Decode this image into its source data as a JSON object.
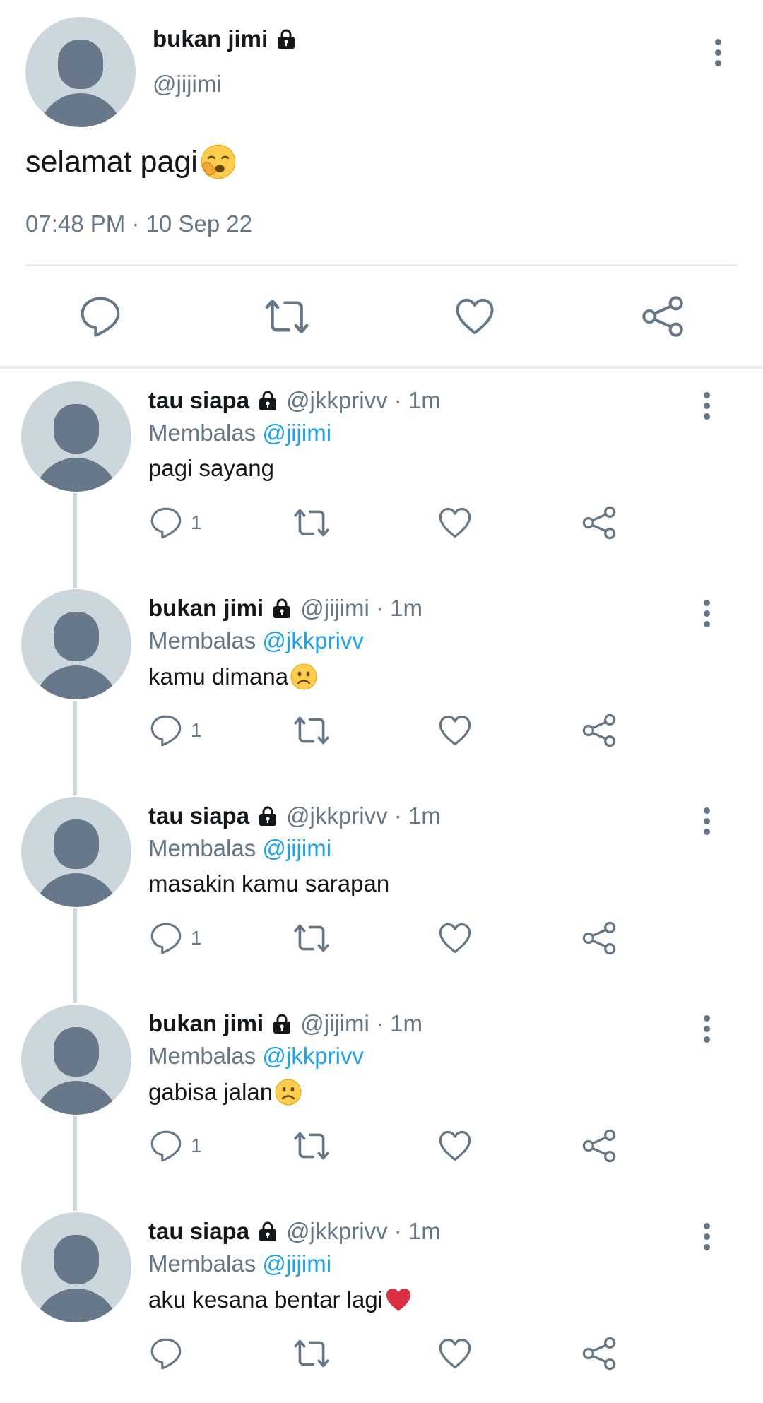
{
  "main_tweet": {
    "name": "bukan jimi",
    "handle": "@jijimi",
    "text": "selamat pagi",
    "text_emoji": "yawning-face-emoji",
    "timestamp": "07:48 PM · 10 Sep 22",
    "actions": [
      "reply-icon",
      "retweet-icon",
      "like-icon",
      "share-icon"
    ]
  },
  "replies": [
    {
      "name": "tau siapa",
      "meta": "@jkkprivv · 1m",
      "replying_prefix": "Membalas ",
      "replying_to": "@jijimi",
      "text": "pagi sayang",
      "reply_count": "1"
    },
    {
      "name": "bukan jimi",
      "meta": "@jijimi · 1m",
      "replying_prefix": "Membalas ",
      "replying_to": "@jkkprivv",
      "text": "kamu dimana",
      "text_emoji": "slightly-frowning-face-emoji",
      "reply_count": "1"
    },
    {
      "name": "tau siapa",
      "meta": "@jkkprivv · 1m",
      "replying_prefix": "Membalas ",
      "replying_to": "@jijimi",
      "text": "masakin kamu sarapan",
      "reply_count": "1"
    },
    {
      "name": "bukan jimi",
      "meta": "@jijimi · 1m",
      "replying_prefix": "Membalas ",
      "replying_to": "@jkkprivv",
      "text": "gabisa jalan",
      "text_emoji": "slightly-frowning-face-emoji",
      "reply_count": "1"
    },
    {
      "name": "tau siapa",
      "meta": "@jkkprivv · 1m",
      "replying_prefix": "Membalas ",
      "replying_to": "@jijimi",
      "text": "aku kesana bentar lagi",
      "text_emoji": "red-heart-emoji",
      "reply_count": ""
    }
  ],
  "colors": {
    "text_primary": "#14171a",
    "text_secondary": "#657786",
    "mention": "#1da1f2",
    "avatar_bg": "#ccd6dd",
    "avatar_fg": "#66788a",
    "divider": "#e6ecf0"
  }
}
